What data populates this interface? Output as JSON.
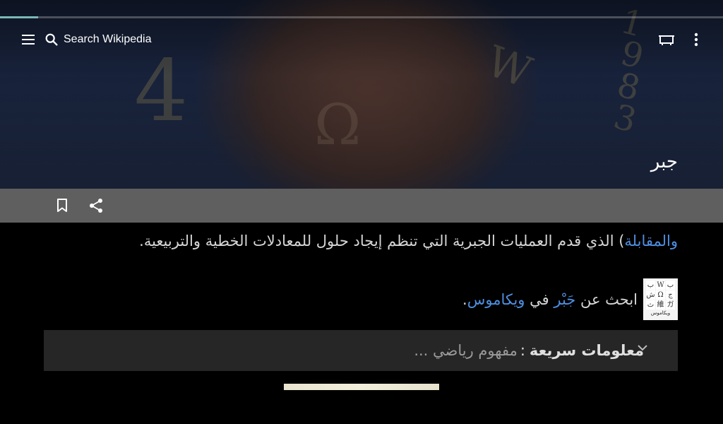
{
  "header": {
    "search_placeholder": "Search Wikipedia",
    "page_title": "جبر",
    "progress_fraction": 0.053,
    "hero_decor_glyphs": [
      "4",
      "Ω",
      "W",
      "1",
      "9",
      "8",
      "3"
    ]
  },
  "content": {
    "paragraph": {
      "link": "والمقابلة",
      "text_after_link": ") الذي قدم العمليات الجبرية التي تنظم إيجاد حلول للمعادلات الخطية والتربيعية."
    },
    "wiktionary": {
      "prefix": "ابحث عن",
      "term": "جَبْر",
      "middle": "في",
      "project": "ويكاموس",
      "suffix": ".",
      "logo_tiles": [
        "ب",
        "W",
        "ب",
        "ج",
        "Ω",
        "ش",
        "ガ",
        "維",
        "ث"
      ],
      "logo_caption": "ويكاموس"
    },
    "quick_facts": {
      "label": "معلومات سريعة",
      "separator": ":",
      "value": "مفهوم رياضي ..."
    }
  },
  "icons": {
    "menu": "menu-icon",
    "search": "search-icon",
    "reading_lists": "reading-list-icon",
    "overflow": "more-vert-icon",
    "bookmark": "bookmark-icon",
    "share": "share-icon",
    "expand": "chevron-down-icon"
  },
  "colors": {
    "link": "#4f8fe0",
    "action_bar": "#5f5f5f",
    "progress": "#7ab8b8",
    "quick_facts_bg": "#262626"
  }
}
